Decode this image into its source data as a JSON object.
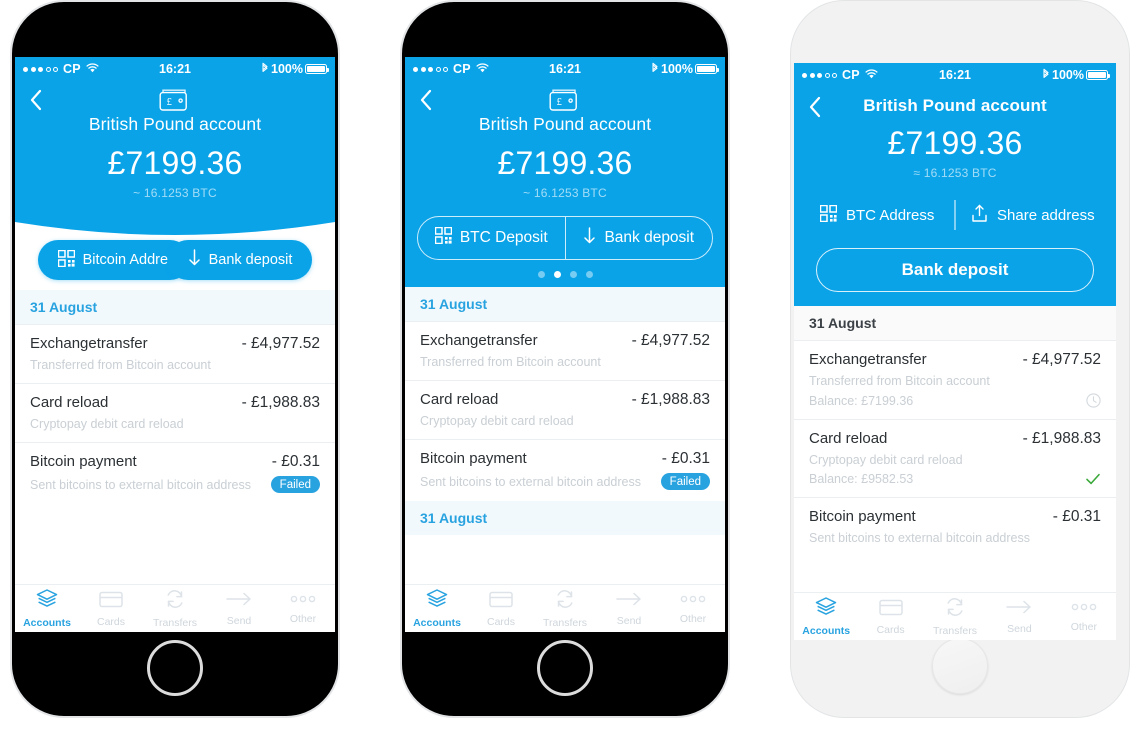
{
  "status_bar": {
    "carrier": "CP",
    "time": "16:21",
    "battery": "100%",
    "signal_dots_filled": 3,
    "signal_dots_total": 5,
    "wifi_icon": "wifi-icon",
    "bluetooth_icon": "bluetooth-icon"
  },
  "account": {
    "title": "British Pound account",
    "balance": "£7199.36",
    "btc_approx_tilde": "~ 16.1253 BTC",
    "btc_approx_almost": "≈ 16.1253 BTC",
    "wallet_icon": "wallet-icon",
    "back_icon": "chevron-left-icon"
  },
  "colors": {
    "brand_blue": "#0aa3e8",
    "accent_blue": "#29a3e0",
    "muted_text": "#c9cfd4",
    "dark_text": "#2b3034",
    "success_green": "#3aa93a",
    "date_bg_blue": "#f2f9fd",
    "date_bg_gray": "#fafafa"
  },
  "screen_one": {
    "buttons": [
      {
        "label": "Bitcoin Address",
        "icon": "qr-code-icon",
        "name": "bitcoin-address-button"
      },
      {
        "label": "Bank deposit",
        "icon": "arrow-down-icon",
        "name": "bank-deposit-button"
      }
    ]
  },
  "screen_two": {
    "segmented": [
      {
        "label": "BTC Deposit",
        "icon": "qr-code-icon",
        "name": "btc-deposit-button"
      },
      {
        "label": "Bank deposit",
        "icon": "arrow-down-icon",
        "name": "bank-deposit-button"
      }
    ],
    "pager": {
      "total": 4,
      "active_index": 1
    }
  },
  "screen_three": {
    "actions": [
      {
        "label": "BTC Address",
        "icon": "qr-code-icon",
        "name": "btc-address-button"
      },
      {
        "label": "Share address",
        "icon": "share-upload-icon",
        "name": "share-address-button"
      }
    ],
    "primary_button": {
      "label": "Bank deposit",
      "name": "bank-deposit-button"
    }
  },
  "date_headers": {
    "first": "31 August",
    "second": "31 August"
  },
  "transactions": [
    {
      "title": "Exchangetransfer",
      "amount": "- £4,977.52",
      "description": "Transferred from Bitcoin account",
      "balance": "Balance: £7199.36",
      "status_icon": "clock-icon",
      "badge": null
    },
    {
      "title": "Card reload",
      "amount": "- £1,988.83",
      "description": "Cryptopay debit card reload",
      "balance": "Balance: £9582.53",
      "status_icon": "check-icon",
      "badge": null
    },
    {
      "title": "Bitcoin payment",
      "amount": "- £0.31",
      "description": "Sent bitcoins to external bitcoin address",
      "balance": "",
      "status_icon": null,
      "badge": "Failed"
    }
  ],
  "tab_bar": [
    {
      "label": "Accounts",
      "icon": "layers-icon",
      "active": true
    },
    {
      "label": "Cards",
      "icon": "credit-card-icon",
      "active": false
    },
    {
      "label": "Transfers",
      "icon": "refresh-icon",
      "active": false
    },
    {
      "label": "Send",
      "icon": "arrow-right-icon",
      "active": false
    },
    {
      "label": "Other",
      "icon": "ellipsis-icon",
      "active": false
    }
  ]
}
